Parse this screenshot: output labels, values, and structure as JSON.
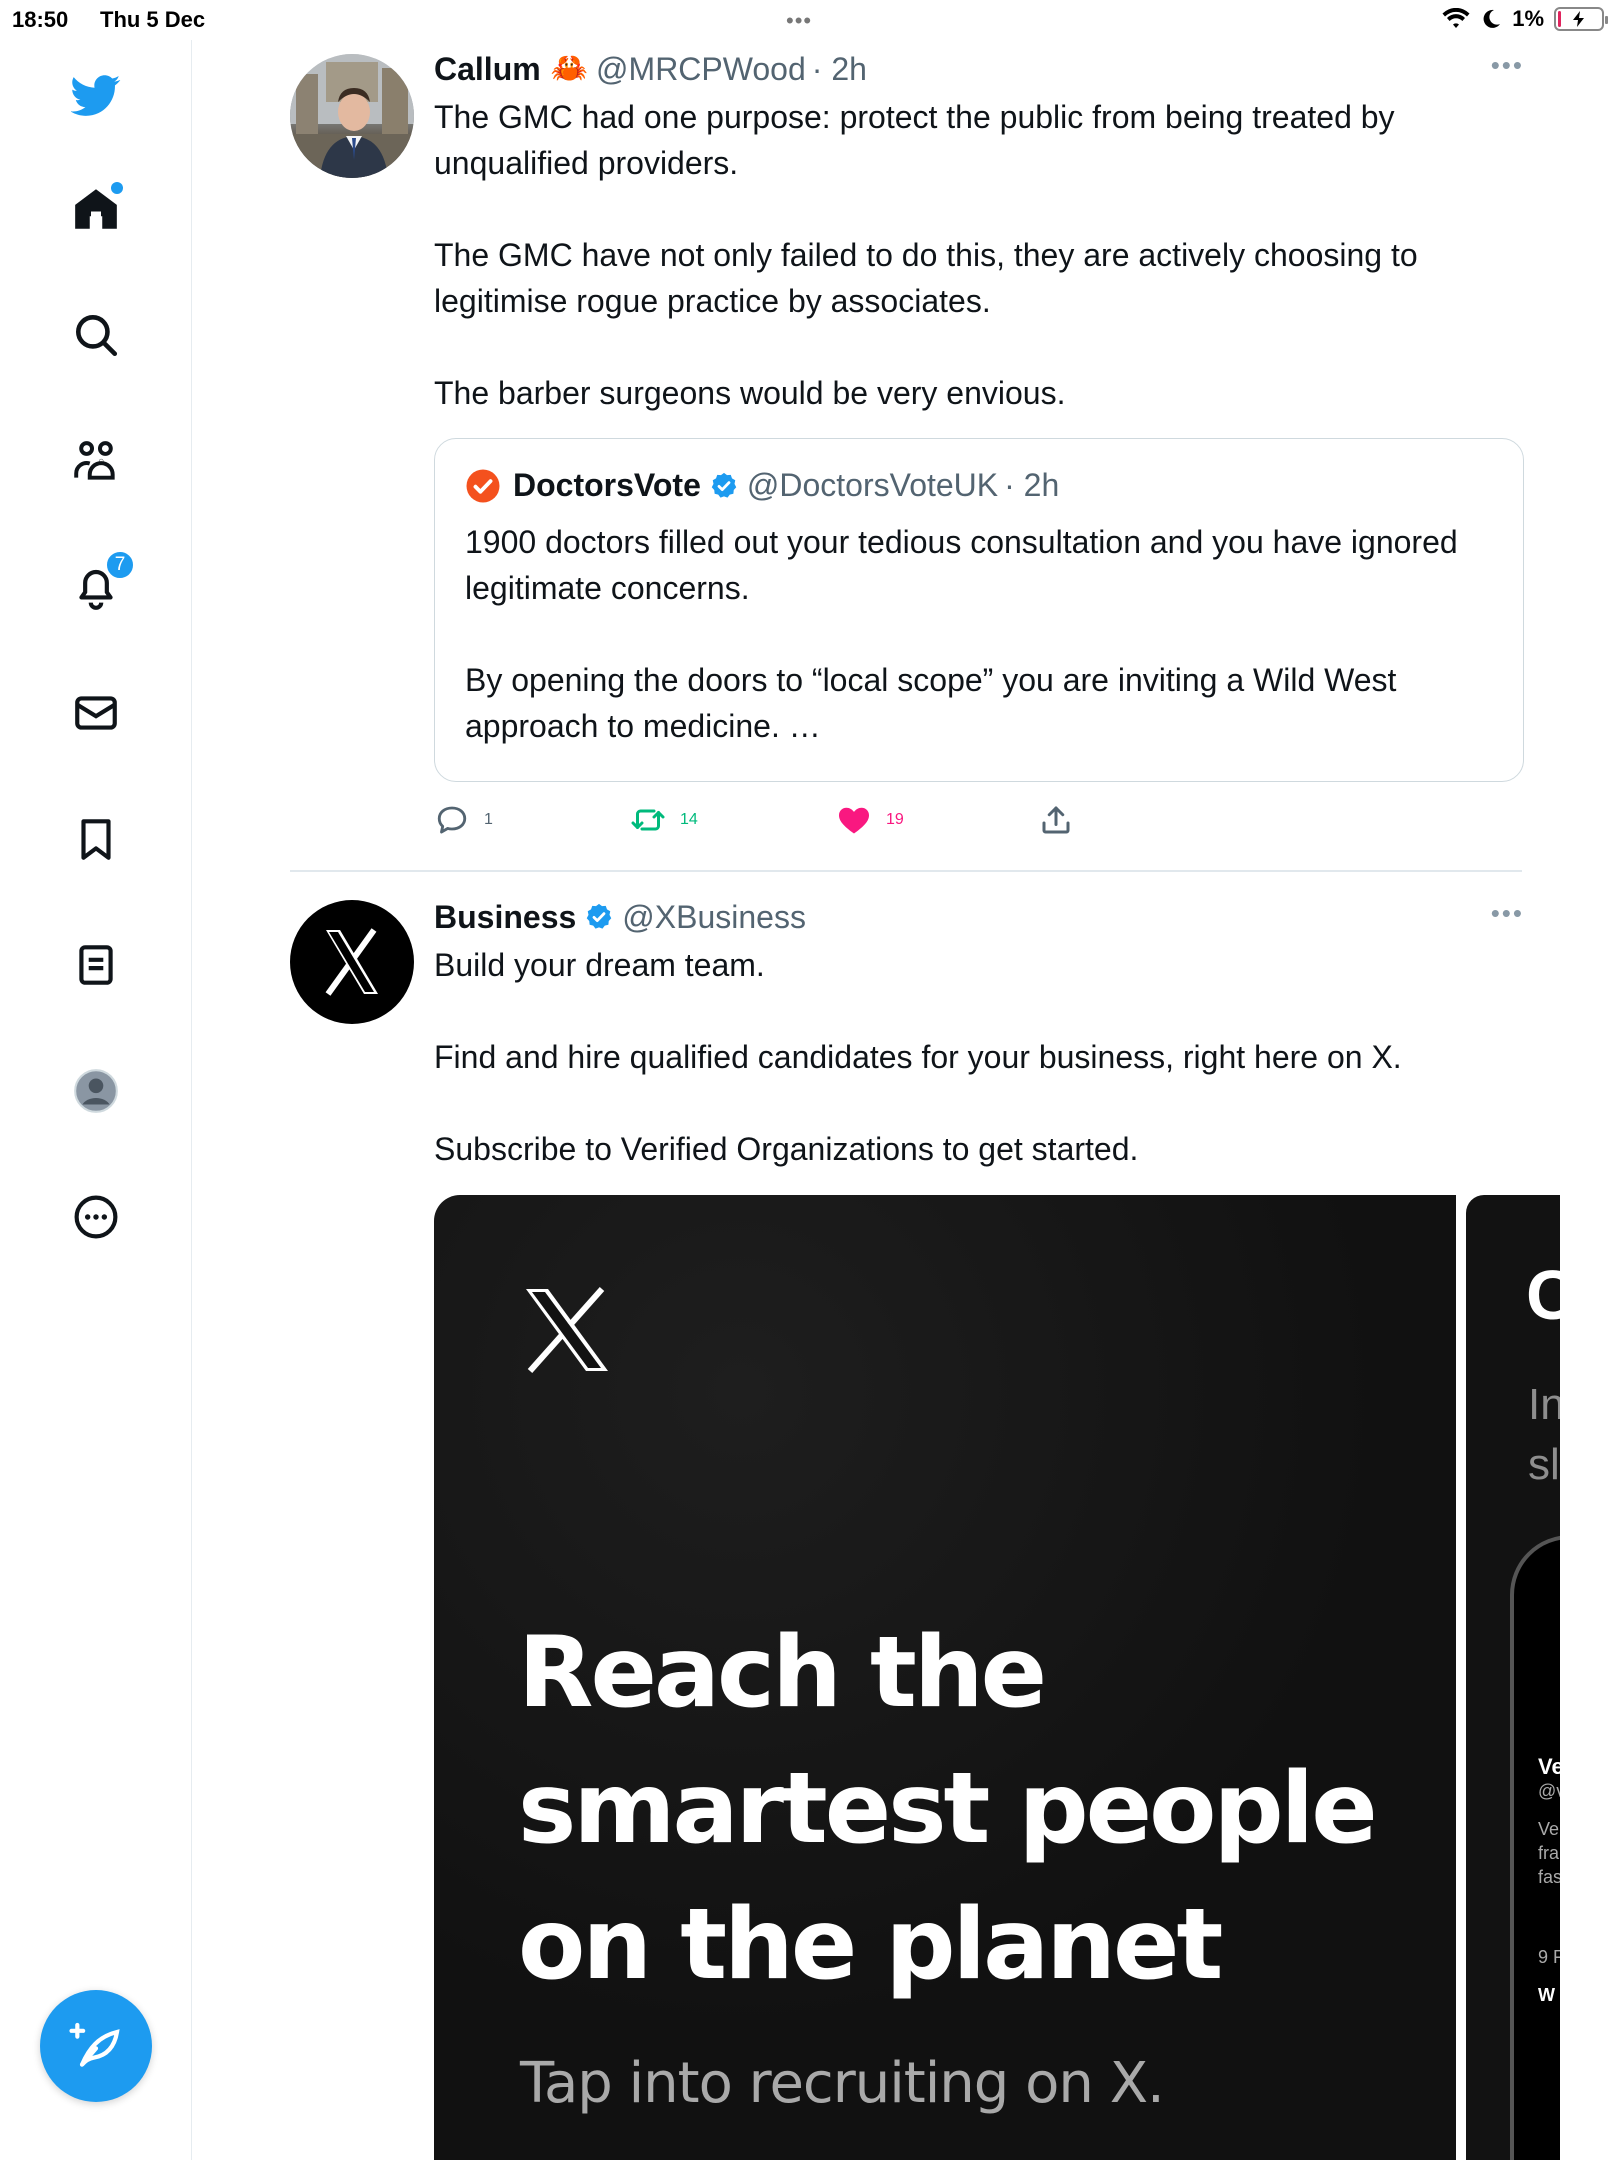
{
  "status_bar": {
    "time": "18:50",
    "date": "Thu 5 Dec",
    "multitask_dots": "•••",
    "battery_percent": "1%"
  },
  "sidebar": {
    "items": [
      {
        "name": "twitter-logo",
        "icon": "twitter-bird-icon"
      },
      {
        "name": "home",
        "icon": "home-icon",
        "has_dot": true
      },
      {
        "name": "explore",
        "icon": "search-icon"
      },
      {
        "name": "communities",
        "icon": "communities-icon"
      },
      {
        "name": "notifications",
        "icon": "bell-icon",
        "badge": "7"
      },
      {
        "name": "messages",
        "icon": "mail-icon"
      },
      {
        "name": "bookmarks",
        "icon": "bookmark-icon"
      },
      {
        "name": "lists",
        "icon": "list-icon"
      },
      {
        "name": "profile",
        "icon": "profile-avatar-icon"
      },
      {
        "name": "more",
        "icon": "more-circle-icon"
      }
    ],
    "notification_badge": "7",
    "compose_icon": "compose-feather-icon"
  },
  "tweets": [
    {
      "display_name": "Callum",
      "emoji": "🦀",
      "handle": "@MRCPWood",
      "time": "· 2h",
      "paragraphs": [
        "The GMC had one purpose: protect the public from being treated by unqualified providers.",
        "The GMC have not only failed to do this, they are actively choosing to legitimise rogue practice by associates.",
        "The barber surgeons would be very envious."
      ],
      "quote": {
        "display_name": "DoctorsVote",
        "handle": "@DoctorsVoteUK",
        "time": "· 2h",
        "paragraphs": [
          "1900 doctors filled out your tedious consultation and you have ignored legitimate concerns.",
          "By opening the doors to “local scope” you are inviting a Wild West approach to medicine. …"
        ]
      },
      "stats": {
        "replies": "1",
        "retweets": "14",
        "likes": "19"
      }
    },
    {
      "display_name": "Business",
      "handle": "@XBusiness",
      "paragraphs": [
        "Build your dream team.",
        "Find and hire qualified candidates for your business, right here on X.",
        "Subscribe to Verified Organizations to get started."
      ],
      "media": {
        "card1_headline": "Reach the smartest people on the planet",
        "card1_sub": "Tap into recruiting on X.",
        "card2_title": "C",
        "card2_text_line1": "In",
        "card2_text_line2": "sl",
        "card2_phone_lines": [
          "Ve",
          "@v",
          "Ve",
          "fra",
          "fas",
          "9 F",
          "W"
        ]
      }
    }
  ],
  "colors": {
    "accent": "#1d9bf0",
    "like": "#f91880",
    "retweet": "#00ba7c",
    "doctorsvote_orange": "#f4511e"
  }
}
